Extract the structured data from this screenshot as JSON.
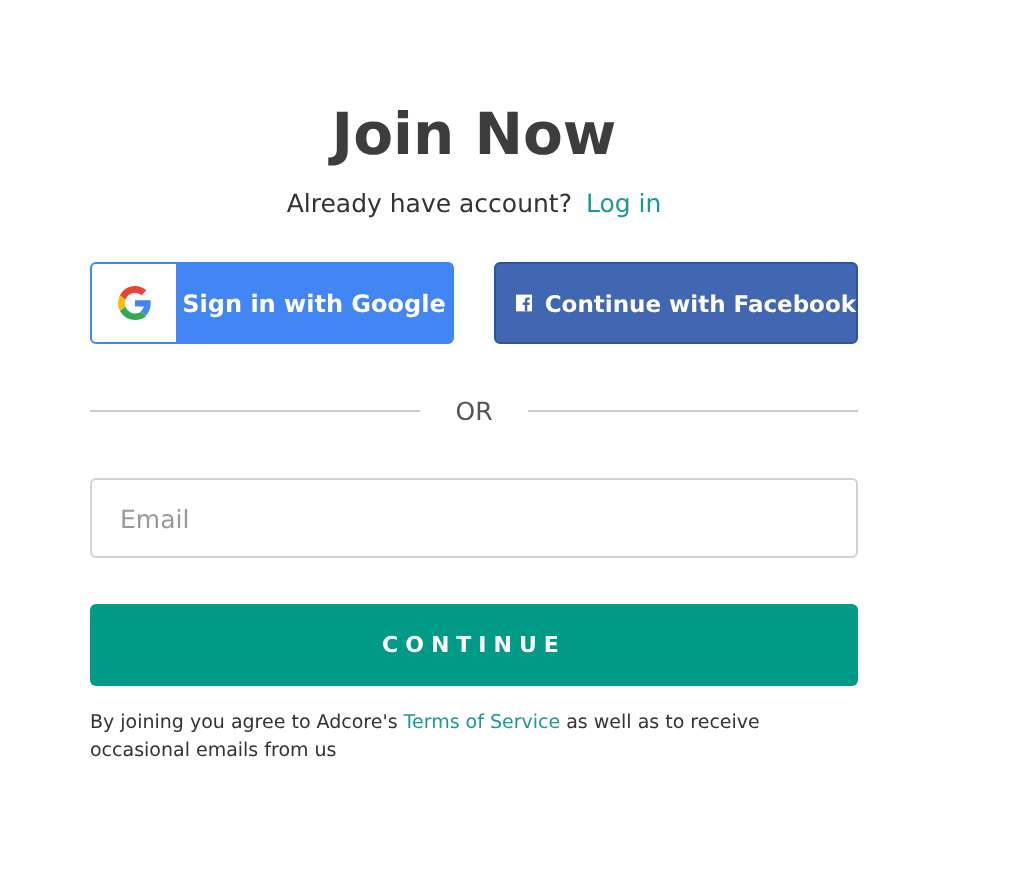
{
  "title": "Join Now",
  "login_prompt": {
    "text": "Already have account?",
    "link": "Log in"
  },
  "social_buttons": [
    {
      "kind": "google",
      "label": "Sign in with Google"
    },
    {
      "kind": "facebook",
      "label": "Continue with Facebook"
    }
  ],
  "divider": "OR",
  "email": {
    "placeholder": "Email"
  },
  "submit": "CONTINUE",
  "terms": {
    "before": "By joining you agree to Adcore's ",
    "link": "Terms of Service",
    "after": " as well as to receive occasional emails from us"
  }
}
